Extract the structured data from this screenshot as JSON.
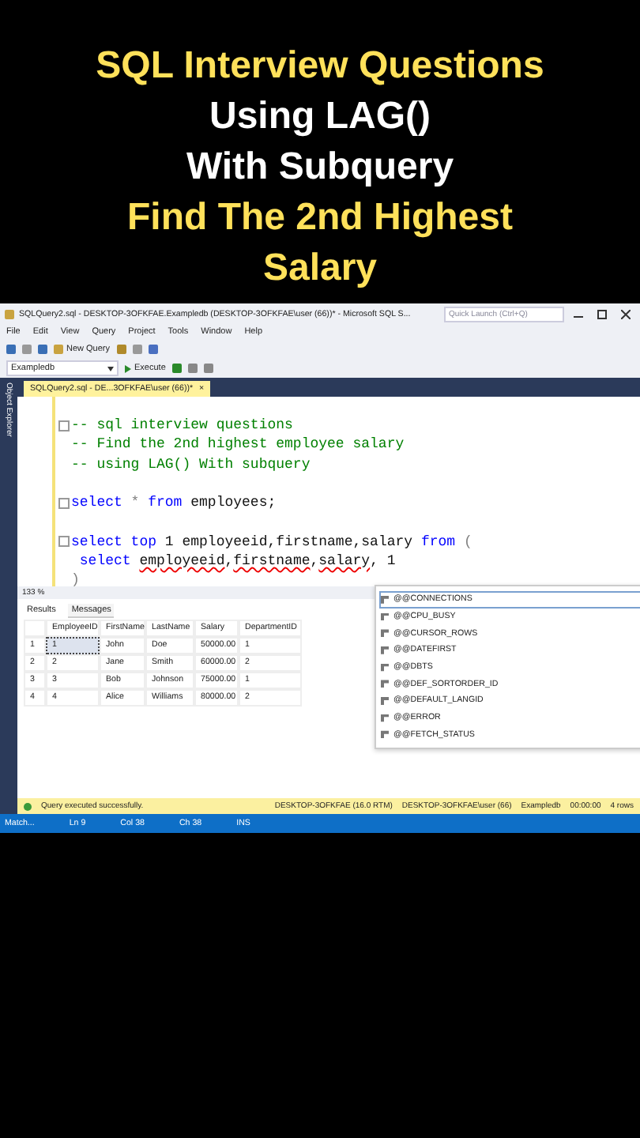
{
  "headline": [
    {
      "text": "SQL Interview Questions",
      "color": "#ffe15a"
    },
    {
      "text": "Using LAG()",
      "color": "#ffffff"
    },
    {
      "text": "With Subquery",
      "color": "#ffffff"
    },
    {
      "text": "Find The 2nd Highest",
      "color": "#ffe15a"
    },
    {
      "text": "Salary",
      "color": "#ffe15a"
    }
  ],
  "window": {
    "title": "SQLQuery2.sql - DESKTOP-3OFKFAE.Exampledb (DESKTOP-3OFKFAE\\user (66))* - Microsoft SQL S...",
    "quick_launch": {
      "placeholder": "Quick Launch (Ctrl+Q)"
    }
  },
  "menu": [
    "File",
    "Edit",
    "View",
    "Query",
    "Project",
    "Tools",
    "Window",
    "Help"
  ],
  "toolbar": {
    "new_query": "New Query",
    "database": "Exampledb",
    "execute": "Execute"
  },
  "side_panel": "Object Explorer",
  "doc_tab": {
    "title": "SQLQuery2.sql - DE...3OFKFAE\\user (66))*",
    "close": "×"
  },
  "editor": {
    "lines": [
      {
        "fold": true,
        "tokens": [
          {
            "kind": "comment",
            "text": "-- sql interview questions"
          }
        ]
      },
      {
        "fold": false,
        "tokens": [
          {
            "kind": "comment",
            "text": "-- Find the 2nd highest employee salary"
          }
        ]
      },
      {
        "fold": false,
        "tokens": [
          {
            "kind": "comment",
            "text": "-- using LAG() With subquery"
          }
        ]
      },
      {
        "fold": false
      },
      {
        "fold": true,
        "tokens": [
          {
            "kind": "keyword",
            "text": "select"
          },
          {
            "kind": "operator",
            "text": " * "
          },
          {
            "kind": "keyword",
            "text": "from"
          },
          {
            "kind": "plain",
            "text": " employees;"
          }
        ]
      },
      {
        "fold": false
      },
      {
        "fold": true,
        "tokens": [
          {
            "kind": "keyword",
            "text": "select"
          },
          {
            "kind": "keyword",
            "text": " top"
          },
          {
            "kind": "plain",
            "text": " 1 employeeid,firstname,salary "
          },
          {
            "kind": "keyword",
            "text": "from"
          },
          {
            "kind": "operator",
            "text": " ("
          }
        ]
      },
      {
        "fold": false,
        "tokens": [
          {
            "kind": "keyword",
            "text": " select "
          },
          {
            "kind": "error",
            "text": "employeeid"
          },
          {
            "kind": "plain",
            "text": ","
          },
          {
            "kind": "error",
            "text": "firstname"
          },
          {
            "kind": "plain",
            "text": ","
          },
          {
            "kind": "error",
            "text": "salary"
          },
          {
            "kind": "plain",
            "text": ", 1"
          }
        ]
      },
      {
        "fold": false,
        "tokens": [
          {
            "kind": "operator",
            "text": ")"
          }
        ]
      }
    ]
  },
  "zoom": "133 %",
  "result_tabs": [
    {
      "label": "Results",
      "selected": true
    },
    {
      "label": "Messages",
      "selected": false
    }
  ],
  "grid": {
    "columns": [
      "EmployeeID",
      "FirstName",
      "LastName",
      "Salary",
      "DepartmentID"
    ],
    "rows": [
      {
        "number": "1",
        "cells": [
          "1",
          "John",
          "Doe",
          "50000.00",
          "1"
        ],
        "selected": true
      },
      {
        "number": "2",
        "cells": [
          "2",
          "Jane",
          "Smith",
          "60000.00",
          "2"
        ],
        "selected": false
      },
      {
        "number": "3",
        "cells": [
          "3",
          "Bob",
          "Johnson",
          "75000.00",
          "1"
        ],
        "selected": false
      },
      {
        "number": "4",
        "cells": [
          "4",
          "Alice",
          "Williams",
          "80000.00",
          "2"
        ],
        "selected": false
      }
    ]
  },
  "autocomplete": [
    {
      "label": "@@CONNECTIONS",
      "selected": true
    },
    {
      "label": "@@CPU_BUSY",
      "selected": false
    },
    {
      "label": "@@CURSOR_ROWS",
      "selected": false
    },
    {
      "label": "@@DATEFIRST",
      "selected": false
    },
    {
      "label": "@@DBTS",
      "selected": false
    },
    {
      "label": "@@DEF_SORTORDER_ID",
      "selected": false
    },
    {
      "label": "@@DEFAULT_LANGID",
      "selected": false
    },
    {
      "label": "@@ERROR",
      "selected": false
    },
    {
      "label": "@@FETCH_STATUS",
      "selected": false
    }
  ],
  "query_status": {
    "message": "Query executed successfully.",
    "server": "DESKTOP-3OFKFAE (16.0 RTM)",
    "user": "DESKTOP-3OFKFAE\\user (66)",
    "database": "Exampledb",
    "time": "00:00:00",
    "rows": "4 rows"
  },
  "status_bar": [
    "Match...",
    "Ln 9",
    "Col 38",
    "Ch 38",
    "INS"
  ]
}
